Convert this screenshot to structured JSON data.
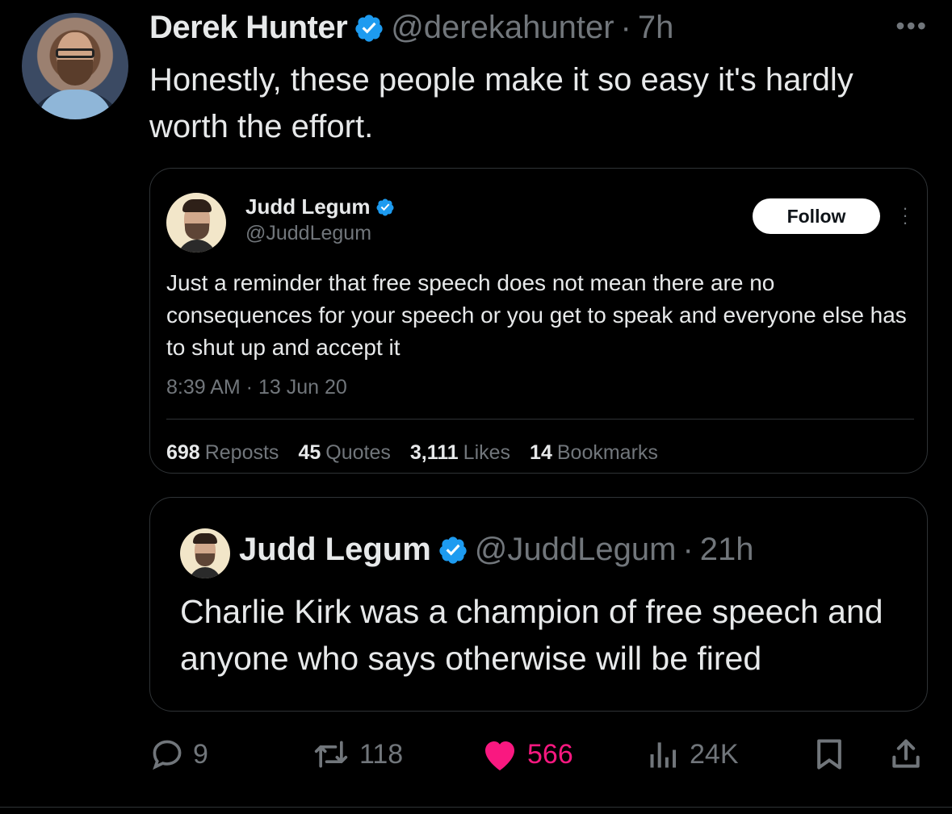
{
  "tweet": {
    "author_name": "Derek Hunter",
    "handle": "@derekahunter",
    "time_separator": "·",
    "time": "7h",
    "text": "Honestly, these people make it so easy it's hardly worth the effort.",
    "more_icon": "more-horizontal-icon"
  },
  "quoted_card": {
    "author_name": "Judd Legum",
    "handle": "@JuddLegum",
    "follow_label": "Follow",
    "text": "Just a reminder that free speech does not mean there are no consequences for your speech or you get to speak and everyone else has to shut up and accept it",
    "timestamp": "8:39 AM · 13 Jun 20",
    "stats": [
      {
        "value": "698",
        "label": "Reposts"
      },
      {
        "value": "45",
        "label": "Quotes"
      },
      {
        "value": "3,111",
        "label": "Likes"
      },
      {
        "value": "14",
        "label": "Bookmarks"
      }
    ]
  },
  "quoted_tweet": {
    "author_name": "Judd Legum",
    "handle": "@JuddLegum",
    "time_separator": "·",
    "time": "21h",
    "text": "Charlie Kirk was a champion of free speech and anyone who says otherwise will be fired"
  },
  "actions": {
    "replies": "9",
    "reposts": "118",
    "likes": "566",
    "views": "24K"
  },
  "colors": {
    "background": "#000000",
    "text": "#e7e9ea",
    "secondary": "#71767b",
    "verified": "#1d9bf0",
    "like": "#f91880",
    "border": "#2f3336"
  }
}
